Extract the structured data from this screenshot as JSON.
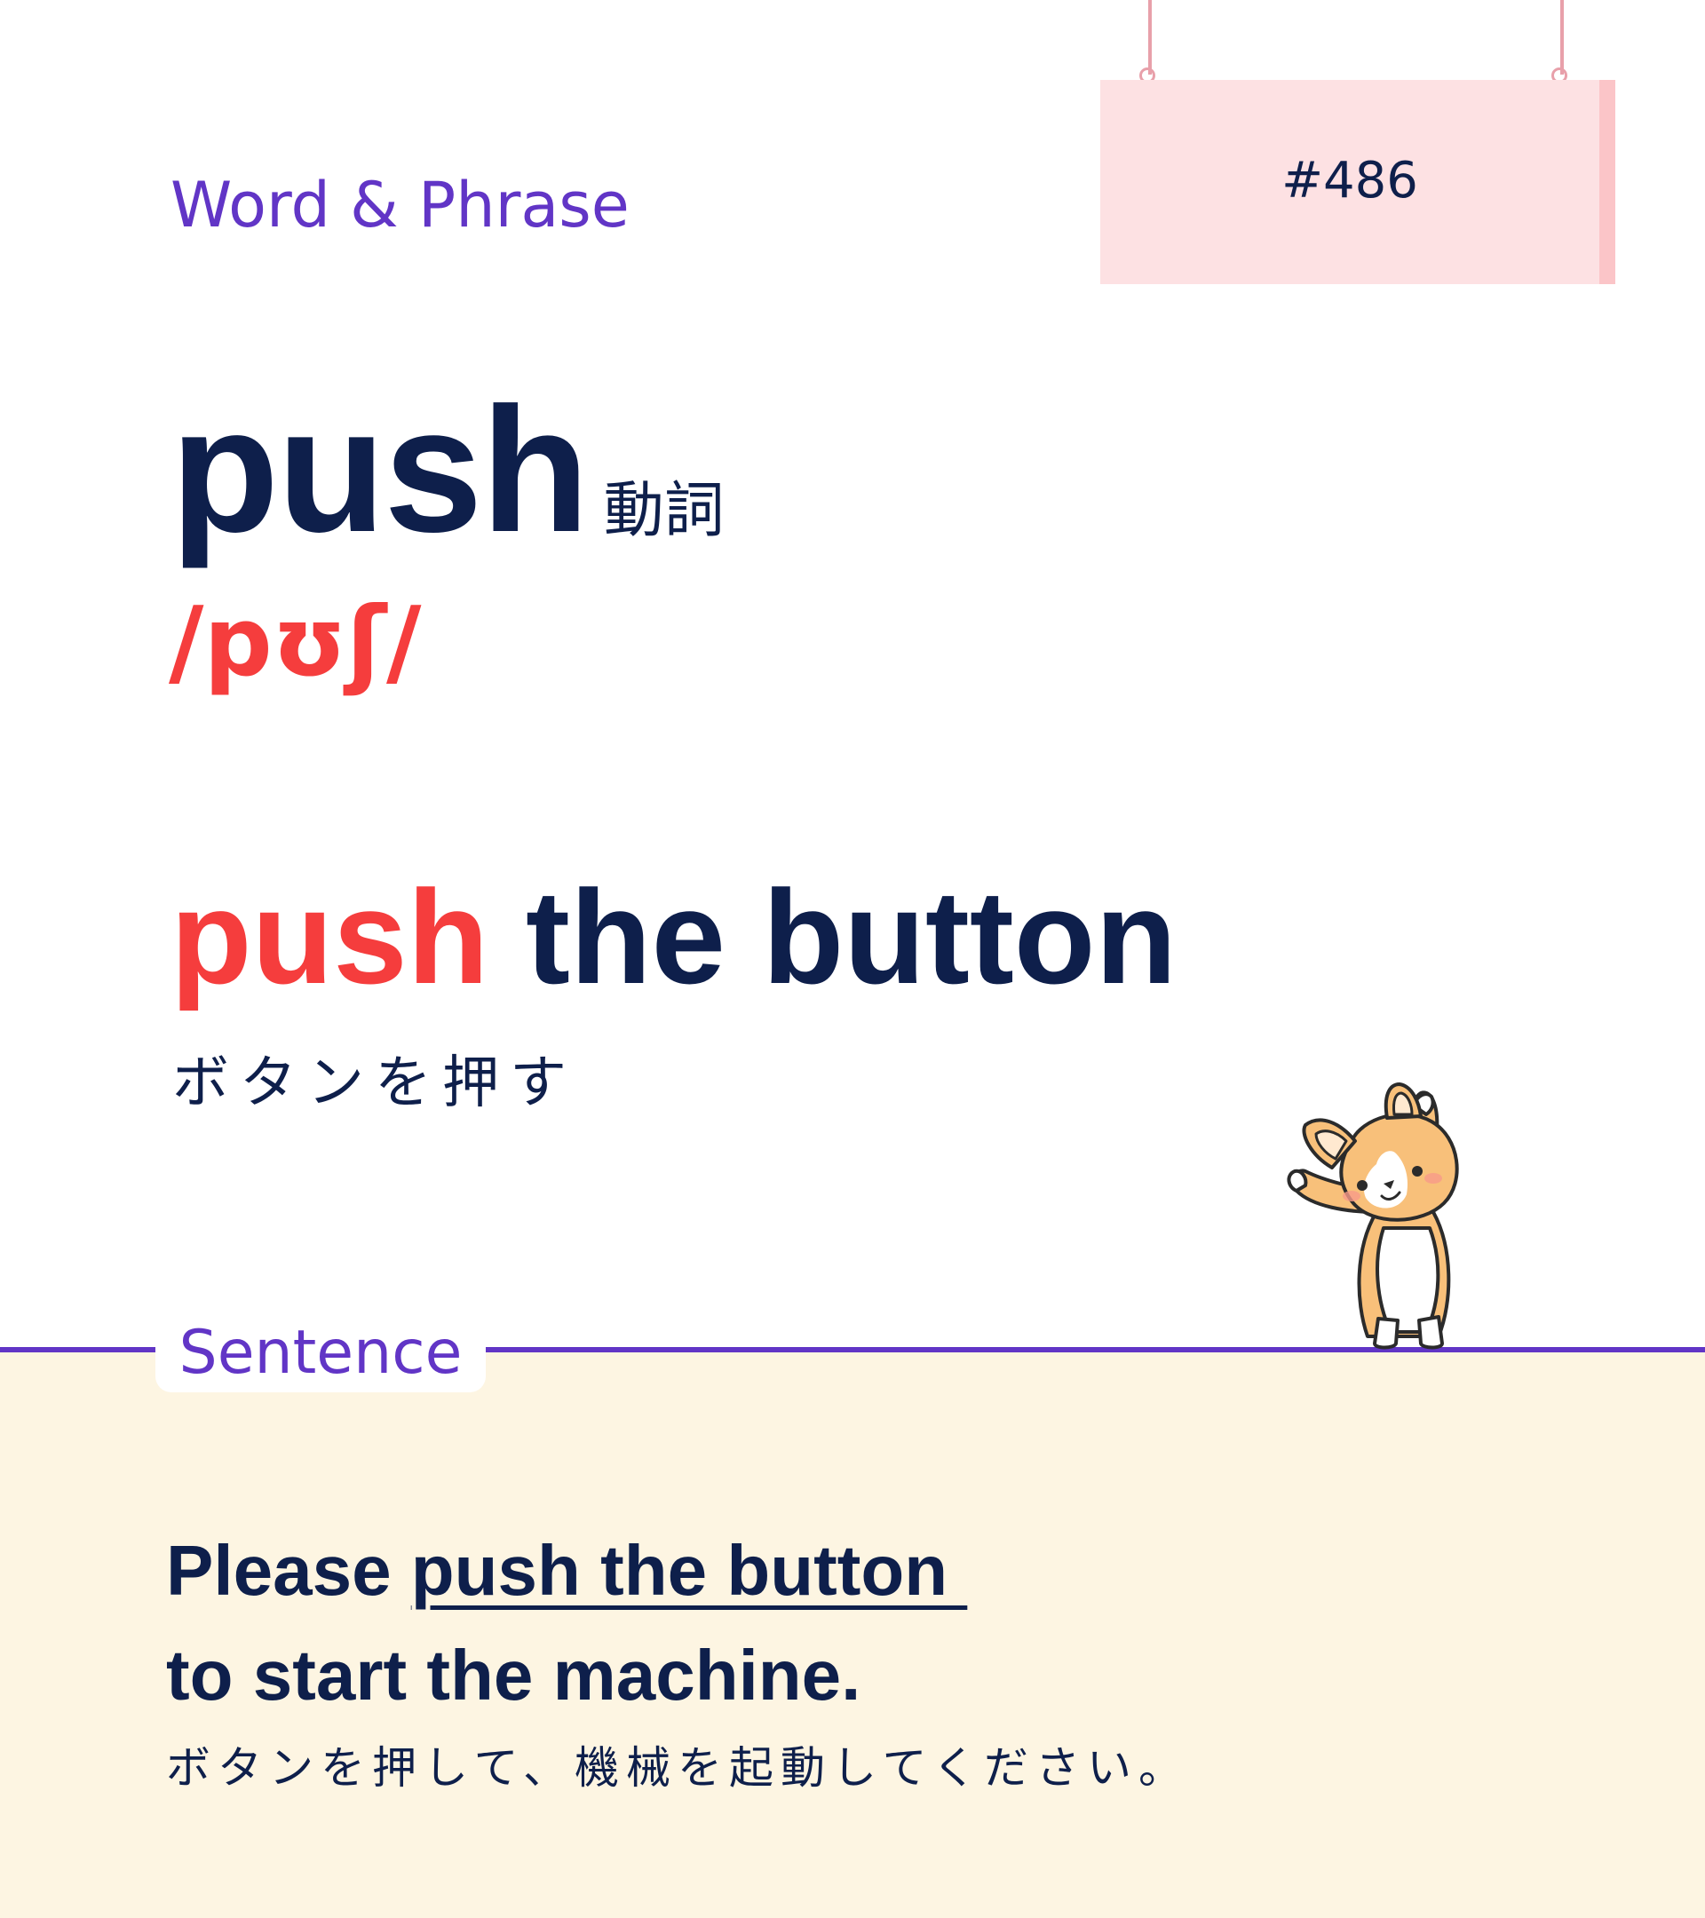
{
  "header": {
    "category": "Word & Phrase",
    "number": "#486"
  },
  "entry": {
    "word": "push",
    "part_of_speech": "動詞",
    "pronunciation": "/pʊʃ/"
  },
  "phrase": {
    "highlight": "push",
    "rest": " the button",
    "translation": "ボタンを押す"
  },
  "sentence_section": {
    "label": "Sentence",
    "line1_start": "Please ",
    "line1_underlined": "push the button ",
    "line2": "to start the machine.",
    "translation": "ボタンを押して、機械を起動してください。"
  },
  "colors": {
    "navy": "#0e1f4b",
    "accent_purple": "#6135c6",
    "accent_red": "#f53d3d",
    "sign_pink": "#fde1e3",
    "panel_cream": "#fdf5e2"
  },
  "illustration": {
    "icon": "corgi-icon"
  }
}
